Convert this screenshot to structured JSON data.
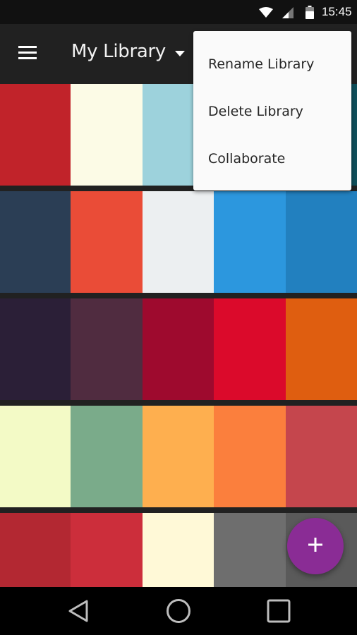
{
  "status_bar": {
    "time": "15:45",
    "icons": [
      "wifi-icon",
      "cell-signal-icon",
      "battery-icon"
    ]
  },
  "app_bar": {
    "title": "My Library",
    "menu_icon": "hamburger-menu-icon",
    "dropdown_icon": "dropdown-arrow-icon"
  },
  "overflow_menu": {
    "items": [
      {
        "label": "Rename Library"
      },
      {
        "label": "Delete Library"
      },
      {
        "label": "Collaborate"
      }
    ]
  },
  "palettes": [
    {
      "colors": [
        "#c1232a",
        "#fcfbe6",
        "#9dd2dc",
        "#2e98d8",
        "#0f4f5a"
      ]
    },
    {
      "colors": [
        "#2b3e55",
        "#ea4c37",
        "#eceff1",
        "#2c97de",
        "#2280bf"
      ]
    },
    {
      "colors": [
        "#2b1f37",
        "#502c40",
        "#9e0a2e",
        "#db0a2b",
        "#df5e10"
      ]
    },
    {
      "colors": [
        "#f3fac6",
        "#7aab8a",
        "#feaf4f",
        "#fb7f3d",
        "#c5464d"
      ]
    },
    {
      "colors": [
        "#b32832",
        "#cc2e3b",
        "#fff9d7",
        "#6e6e6e",
        "#5a5a5a"
      ]
    }
  ],
  "fab": {
    "label": "+",
    "icon": "add-icon",
    "color": "#8a2c95"
  },
  "nav_bar": {
    "buttons": [
      "back-icon",
      "home-icon",
      "recents-icon"
    ]
  }
}
